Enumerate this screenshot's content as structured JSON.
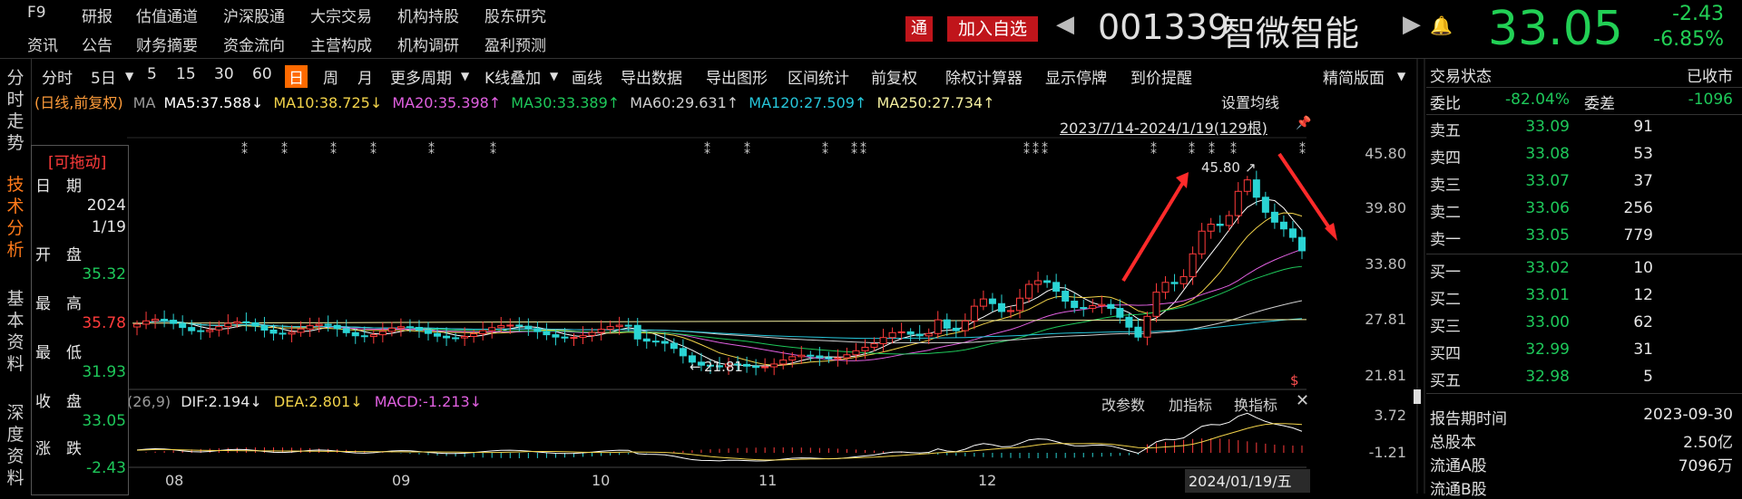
{
  "menu": {
    "row1": [
      "F9",
      "研报",
      "估值通道",
      "沪深股通",
      "大宗交易",
      "机构持股",
      "股东研究"
    ],
    "row2": [
      "资讯",
      "公告",
      "财务摘要",
      "资金流向",
      "主营构成",
      "机构调研",
      "盈利预测"
    ]
  },
  "header": {
    "tong_label": "通",
    "add_label": "加入自选",
    "code": "001339",
    "name": "智微智能",
    "price": "33.05",
    "change": "-2.43",
    "change_pct": "-6.85%"
  },
  "left_tabs": [
    {
      "label": "分时走势",
      "active": false
    },
    {
      "label": "技术分析",
      "active": true
    },
    {
      "label": "基本资料",
      "active": false
    },
    {
      "label": "深度资料",
      "active": false
    }
  ],
  "toolbar": {
    "periods": [
      "分时",
      "5日",
      "5",
      "15",
      "30",
      "60",
      "日",
      "周",
      "月"
    ],
    "active_period": "日",
    "tools": [
      "更多周期",
      "K线叠加",
      "画线",
      "导出数据",
      "导出图形",
      "区间统计",
      "前复权",
      "除权计算器",
      "显示停牌",
      "到价提醒"
    ],
    "right_label": "精简版面"
  },
  "ma_line": {
    "mode": "(日线,前复权)",
    "ma_label": "MA",
    "items": [
      {
        "text": "MA5:37.588↓",
        "color": "#ffffff"
      },
      {
        "text": "MA10:38.725↓",
        "color": "#f2d34a"
      },
      {
        "text": "MA20:35.398↑",
        "color": "#e060e0"
      },
      {
        "text": "MA30:33.389↑",
        "color": "#1ec85a"
      },
      {
        "text": "MA60:29.631↑",
        "color": "#d0d0d0"
      },
      {
        "text": "MA120:27.509↑",
        "color": "#26c6da"
      },
      {
        "text": "MA250:27.734↑",
        "color": "#f5f0a0"
      }
    ],
    "settings": "设置均线",
    "range": "2023/7/14-2024/1/19(129根)"
  },
  "info_box": {
    "title": "[可拖动]",
    "date_label": "日　期",
    "year": "2024",
    "md": "1/19",
    "open_label": "开　盘",
    "open": "35.32",
    "high_label": "最　高",
    "high": "35.78",
    "low_label": "最　低",
    "low": "31.93",
    "close_label": "收　盘",
    "close": "33.05",
    "chg_label": "涨　跌",
    "chg": "-2.43"
  },
  "chart_data": {
    "type": "candlestick",
    "y_ticks": [
      "45.80",
      "39.80",
      "33.80",
      "27.81",
      "21.81"
    ],
    "macd_ticks": [
      "3.72",
      "-1.21"
    ],
    "x_labels": [
      "08",
      "09",
      "10",
      "11",
      "12"
    ],
    "high_annotation": "45.80",
    "low_annotation": "21.81",
    "cursor_date": "2024/01/19/五",
    "macd": {
      "params": "(26,9)",
      "dif": "DIF:2.194↓",
      "dea": "DEA:2.801↓",
      "macd": "MACD:-1.213↓",
      "buttons": [
        "改参数",
        "加指标",
        "换指标"
      ]
    }
  },
  "right_panel": {
    "status_label": "交易状态",
    "status": "已收市",
    "webi_label": "委比",
    "webi": "-82.04%",
    "weicha_label": "委差",
    "weicha": "-1096",
    "asks": [
      {
        "label": "卖五",
        "price": "33.09",
        "vol": "91"
      },
      {
        "label": "卖四",
        "price": "33.08",
        "vol": "53"
      },
      {
        "label": "卖三",
        "price": "33.07",
        "vol": "37"
      },
      {
        "label": "卖二",
        "price": "33.06",
        "vol": "256"
      },
      {
        "label": "卖一",
        "price": "33.05",
        "vol": "779"
      }
    ],
    "bids": [
      {
        "label": "买一",
        "price": "33.02",
        "vol": "10"
      },
      {
        "label": "买二",
        "price": "33.01",
        "vol": "12"
      },
      {
        "label": "买三",
        "price": "33.00",
        "vol": "62"
      },
      {
        "label": "买四",
        "price": "32.99",
        "vol": "31"
      },
      {
        "label": "买五",
        "price": "32.98",
        "vol": "5"
      }
    ],
    "report_label": "报告期时间",
    "report": "2023-09-30",
    "total_label": "总股本",
    "total": "2.50亿",
    "float_label": "流通A股",
    "float": "7096万",
    "float_b_label": "流通B股"
  }
}
